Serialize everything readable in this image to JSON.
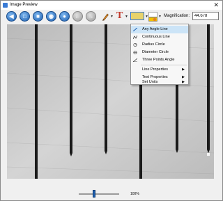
{
  "window": {
    "title": "Image Preview",
    "close_glyph": "✕"
  },
  "toolbar": {
    "buttons": [
      {
        "name": "rewind-icon",
        "glyph": "◀"
      },
      {
        "name": "open-icon",
        "glyph": "□"
      },
      {
        "name": "save-icon",
        "glyph": "■"
      },
      {
        "name": "capture-icon",
        "glyph": "◉"
      },
      {
        "name": "record-icon",
        "glyph": "●"
      },
      {
        "name": "undo-icon",
        "glyph": "←"
      },
      {
        "name": "redo-icon",
        "glyph": "→"
      }
    ],
    "magnification_label": "Magnification:",
    "magnification_value": "44.678"
  },
  "measure_menu": {
    "items": [
      {
        "label": "Any Angle Line",
        "icon": "angle-line-icon"
      },
      {
        "label": "Continuous Line",
        "icon": "continuous-line-icon"
      },
      {
        "label": "Radius Circle",
        "icon": "radius-circle-icon"
      },
      {
        "label": "Diameter Circle",
        "icon": "diameter-circle-icon"
      },
      {
        "label": "Three Points Angle",
        "icon": "three-points-angle-icon"
      }
    ],
    "sub_items": [
      {
        "label": "Line Properties",
        "arrow": "▶"
      },
      {
        "label": "Text Properties",
        "arrow": "▶"
      },
      {
        "label": "Set Units",
        "arrow": "▶"
      }
    ]
  },
  "statusbar": {
    "zoom": "100%"
  },
  "colors": {
    "accent": "#1d5fb0",
    "highlight": "#cce4f7",
    "ruler_line": "#1a1a1a"
  }
}
